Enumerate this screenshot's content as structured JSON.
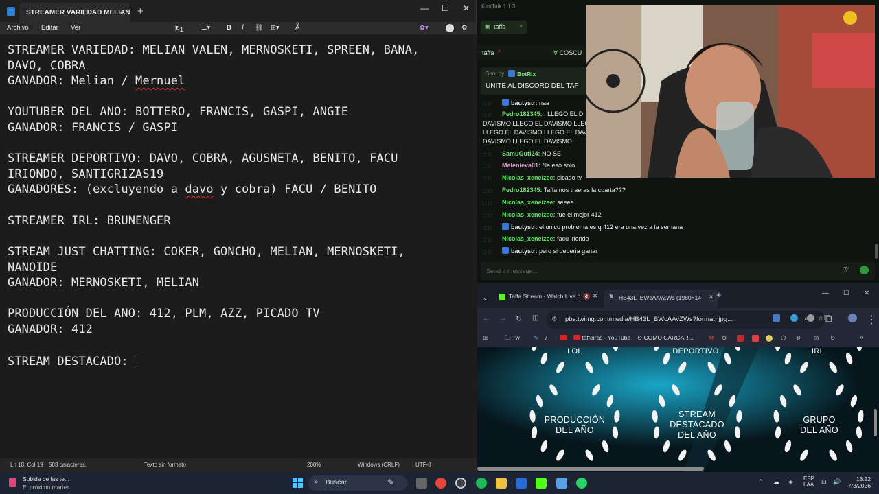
{
  "notepad": {
    "tab_title": "STREAMER VARIEDAD MELIAN VAL",
    "menu": [
      "Archivo",
      "Editar",
      "Ver"
    ],
    "heading_select": "H1",
    "lines": [
      "STREAMER VARIEDAD: MELIAN VALEN, MERNOSKETI, SPREEN, BANA,",
      "DAVO, COBRA",
      "GANADOR: Melian / ",
      "Mernuel",
      "YOUTUBER DEL ANO: BOTTERO, FRANCIS, GASPI, ANGIE",
      "GANADOR: FRANCIS / GASPI",
      "STREAMER DEPORTIVO: DAVO, COBRA, AGUSNETA, BENITO, FACU",
      "IRIONDO, SANTIGRIZAS19",
      "GANADORES: (excluyendo a ",
      "davo",
      " y cobra) FACU / BENITO",
      "STREAMER IRL: BRUNENGER",
      "STREAM JUST CHATTING: COKER, GONCHO, MELIAN, MERNOSKETI,",
      "NANOIDE",
      "GANADOR: MERNOSKETI, MELIAN",
      "PRODUCCIÓN DEL ANO: 412, PLM, AZZ, PICADO TV",
      "GANADOR: 412",
      "STREAM DESTACADO: "
    ],
    "status": {
      "position": "Ln 18, Col 19",
      "chars": "503 caracteres.",
      "format": "Texto sin formato",
      "zoom": "200%",
      "eol": "Windows (CRLF)",
      "encoding": "UTF-8"
    }
  },
  "chat": {
    "app_title": "KickTalk 1.1.3",
    "tab": "taffa",
    "channel_label": "taffa",
    "other_channel": "COSCU",
    "pinned_sender_label": "Sent by",
    "pinned_sender": "BotRix",
    "pinned_text": "UNITE AL DISCORD DEL TAF",
    "messages": [
      {
        "user": "bautystr:",
        "text": "naa",
        "color": "white",
        "badge": true
      },
      {
        "user": "Pedro182345:",
        "text": ": LLEGO EL D",
        "color": "green",
        "badge": false
      },
      {
        "user": "",
        "text": "DAVISMO LLEGO EL DAVISMO LLEGO",
        "color": "white",
        "badge": false
      },
      {
        "user": "",
        "text": "LLEGO EL DAVISMO LLEGO EL DAVIS",
        "color": "white",
        "badge": false
      },
      {
        "user": "",
        "text": "DAVISMO LLEGO EL DAVISMO",
        "color": "white",
        "badge": false
      },
      {
        "user": "SamuGuti24:",
        "text": "NO SE",
        "color": "green",
        "badge": false
      },
      {
        "user": "Malenieva01:",
        "text": "Na eso solo.",
        "color": "pink",
        "badge": false
      },
      {
        "user": "Nicolas_xeneizee:",
        "text": "picado tv.",
        "color": "lime",
        "badge": false
      },
      {
        "user": "Pedro182345:",
        "text": "Taffa nos traeras la cuarta???",
        "color": "green",
        "badge": false
      },
      {
        "user": "Nicolas_xeneizee:",
        "text": "seeee",
        "color": "lime",
        "badge": false
      },
      {
        "user": "Nicolas_xeneizee:",
        "text": "fue el mejor 412",
        "color": "lime",
        "badge": false
      },
      {
        "user": "bautystr:",
        "text": "el unico problema es q 412 era una vez a la semana",
        "color": "white",
        "badge": true
      },
      {
        "user": "Nicolas_xeneizee:",
        "text": "facu iriondo",
        "color": "lime",
        "badge": false
      },
      {
        "user": "bautystr:",
        "text": "pero si deberia ganar",
        "color": "white",
        "badge": true
      }
    ],
    "input_placeholder": "Send a message..."
  },
  "browser": {
    "tab1": "Taffa Stream - Watch Live o",
    "tab2": "HB43L_BWcAAvZWs (1980×14",
    "url": "pbs.twimg.com/media/HB43L_BWcAAvZWs?format=jpg...",
    "bookmarks": [
      "Tw",
      "taffeiras - YouTube",
      "COMO CARGAR..."
    ],
    "awards_top": [
      "LOL",
      "DEPORTIVO",
      "IRL"
    ],
    "awards": [
      {
        "line1": "PRODUCCIÓN",
        "line2": "DEL AÑO",
        "line3": ""
      },
      {
        "line1": "STREAM",
        "line2": "DESTACADO",
        "line3": "DEL AÑO"
      },
      {
        "line1": "GRUPO",
        "line2": "DEL AÑO",
        "line3": ""
      }
    ]
  },
  "taskbar": {
    "notif_title": "Subida de las te...",
    "notif_sub": "El próximo martes",
    "search_placeholder": "Buscar",
    "lang1": "ESP",
    "lang2": "LAA",
    "time": "18:22",
    "date": "7/3/2026"
  }
}
